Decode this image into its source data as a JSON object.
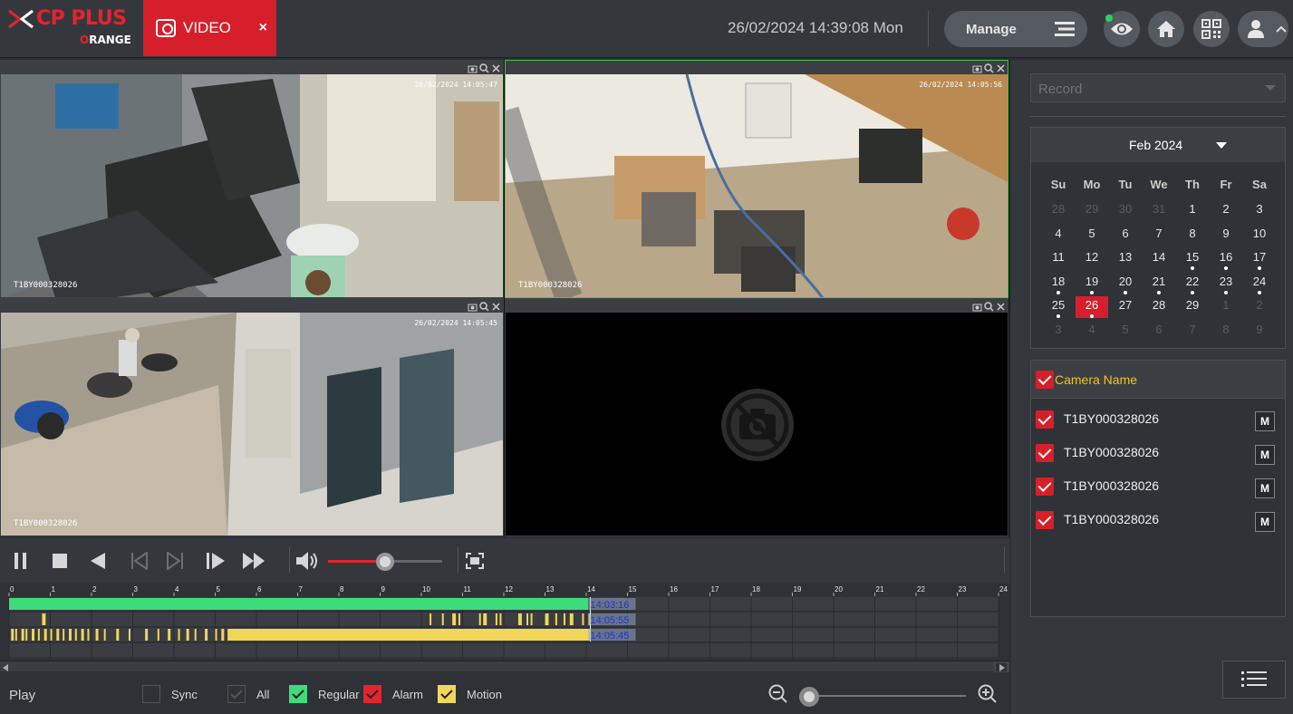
{
  "header": {
    "brand": "CP PLUS",
    "brand_sub": "RANGE",
    "tab_label": "VIDEO",
    "tab_close": "×",
    "datetime": "26/02/2024 14:39:08 Mon",
    "manage_label": "Manage",
    "icons": [
      "live-eye-icon",
      "home-icon",
      "qr-code-icon",
      "user-icon"
    ]
  },
  "panes": [
    {
      "camera": "T1BY000328026",
      "timestamp": "26/02/2024 14:05:47",
      "active": false
    },
    {
      "camera": "T1BY000328026",
      "timestamp": "26/02/2024 14:05:56",
      "active": true
    },
    {
      "camera": "T1BY000328026",
      "timestamp": "26/02/2024 14:05:45",
      "active": false
    },
    {
      "camera": "",
      "timestamp": "",
      "active": false,
      "no_video": true
    }
  ],
  "playback": {
    "volume_level": 0.5
  },
  "timeline": {
    "hours": [
      "0",
      "1",
      "2",
      "3",
      "4",
      "5",
      "6",
      "7",
      "8",
      "9",
      "10",
      "11",
      "12",
      "13",
      "14",
      "15",
      "16",
      "17",
      "18",
      "19",
      "20",
      "21",
      "22",
      "23",
      "24"
    ],
    "tracks": [
      {
        "type": "regular",
        "color": "#3ddb7a",
        "label": "14:03:16",
        "end_hour": 14.05
      },
      {
        "type": "alarm",
        "color": "#f1d65a",
        "label": "14:05:55"
      },
      {
        "type": "motion",
        "color": "#f1d65a",
        "label": "14:05:45",
        "end_hour": 14.1
      }
    ]
  },
  "footer": {
    "play_label": "Play",
    "sync_label": "Sync",
    "all_label": "All",
    "regular_label": "Regular",
    "alarm_label": "Alarm",
    "motion_label": "Motion",
    "colors": {
      "regular": "#3ddb7a",
      "alarm": "#e6232e",
      "motion": "#f1d65a"
    }
  },
  "rightpanel": {
    "record_select": "Record",
    "calendar": {
      "month": "Feb 2024",
      "dow": [
        "Su",
        "Mo",
        "Tu",
        "We",
        "Th",
        "Fr",
        "Sa"
      ],
      "weeks": [
        [
          {
            "d": "28",
            "o": 1
          },
          {
            "d": "29",
            "o": 1
          },
          {
            "d": "30",
            "o": 1
          },
          {
            "d": "31",
            "o": 1
          },
          {
            "d": "1"
          },
          {
            "d": "2"
          },
          {
            "d": "3"
          }
        ],
        [
          {
            "d": "4"
          },
          {
            "d": "5"
          },
          {
            "d": "6"
          },
          {
            "d": "7"
          },
          {
            "d": "8"
          },
          {
            "d": "9"
          },
          {
            "d": "10"
          }
        ],
        [
          {
            "d": "11"
          },
          {
            "d": "12"
          },
          {
            "d": "13"
          },
          {
            "d": "14"
          },
          {
            "d": "15",
            "r": 1
          },
          {
            "d": "16",
            "r": 1
          },
          {
            "d": "17",
            "r": 1
          }
        ],
        [
          {
            "d": "18",
            "r": 1
          },
          {
            "d": "19",
            "r": 1
          },
          {
            "d": "20",
            "r": 1
          },
          {
            "d": "21",
            "r": 1
          },
          {
            "d": "22",
            "r": 1
          },
          {
            "d": "23",
            "r": 1
          },
          {
            "d": "24",
            "r": 1
          }
        ],
        [
          {
            "d": "25",
            "r": 1
          },
          {
            "d": "26",
            "r": 1,
            "s": 1
          },
          {
            "d": "27"
          },
          {
            "d": "28"
          },
          {
            "d": "29"
          },
          {
            "d": "1",
            "o": 1
          },
          {
            "d": "2",
            "o": 1
          }
        ],
        [
          {
            "d": "3",
            "o": 1
          },
          {
            "d": "4",
            "o": 1
          },
          {
            "d": "5",
            "o": 1
          },
          {
            "d": "6",
            "o": 1
          },
          {
            "d": "7",
            "o": 1
          },
          {
            "d": "8",
            "o": 1
          },
          {
            "d": "9",
            "o": 1
          }
        ]
      ]
    },
    "camera_header": "Camera Name",
    "cameras": [
      {
        "name": "T1BY000328026",
        "m": "M"
      },
      {
        "name": "T1BY000328026",
        "m": "M"
      },
      {
        "name": "T1BY000328026",
        "m": "M"
      },
      {
        "name": "T1BY000328026",
        "m": "M"
      }
    ]
  }
}
